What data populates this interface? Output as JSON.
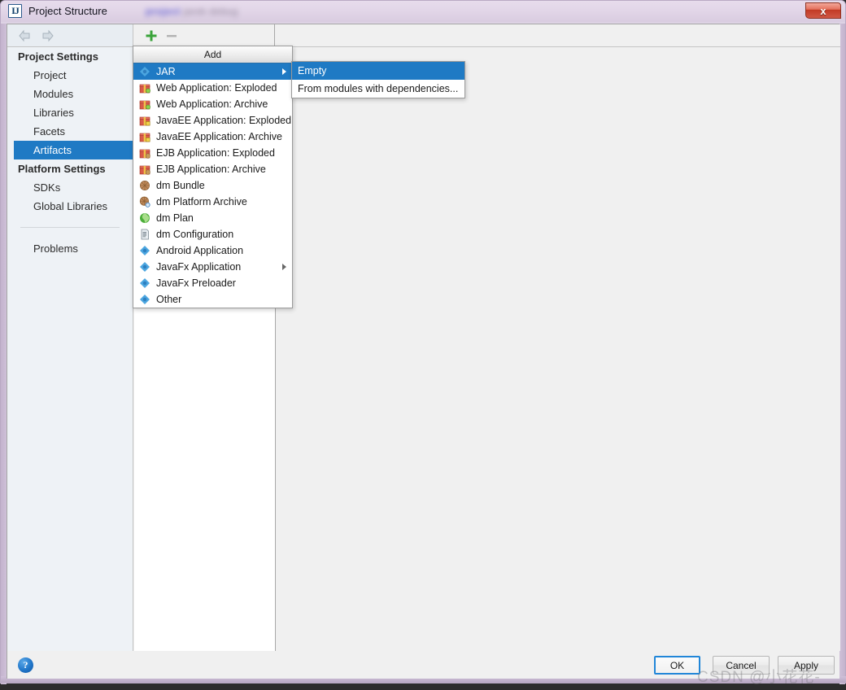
{
  "window": {
    "title": "Project Structure",
    "subtitle_blurred": "project  jarek  debug",
    "app_icon": "intellij-idea-icon",
    "close_label": "x"
  },
  "nav": {
    "back_icon": "arrow-left-icon",
    "forward_icon": "arrow-right-icon"
  },
  "toolbar": {
    "add_icon": "plus-icon",
    "remove_icon": "minus-icon"
  },
  "sidebar": {
    "groups": [
      {
        "label": "Project Settings",
        "items": [
          {
            "label": "Project",
            "selected": false
          },
          {
            "label": "Modules",
            "selected": false
          },
          {
            "label": "Libraries",
            "selected": false
          },
          {
            "label": "Facets",
            "selected": false
          },
          {
            "label": "Artifacts",
            "selected": true
          }
        ]
      },
      {
        "label": "Platform Settings",
        "items": [
          {
            "label": "SDKs",
            "selected": false
          },
          {
            "label": "Global Libraries",
            "selected": false
          }
        ]
      }
    ],
    "extra_items": [
      {
        "label": "Problems",
        "selected": false
      }
    ]
  },
  "add_menu": {
    "header": "Add",
    "items": [
      {
        "label": "JAR",
        "icon": "diamond-blue-icon",
        "selected": true,
        "has_submenu": true
      },
      {
        "label": "Web Application: Exploded",
        "icon": "web-exploded-icon",
        "selected": false,
        "has_submenu": false
      },
      {
        "label": "Web Application: Archive",
        "icon": "web-archive-icon",
        "selected": false,
        "has_submenu": false
      },
      {
        "label": "JavaEE Application: Exploded",
        "icon": "javaee-exploded-icon",
        "selected": false,
        "has_submenu": false
      },
      {
        "label": "JavaEE Application: Archive",
        "icon": "javaee-archive-icon",
        "selected": false,
        "has_submenu": false
      },
      {
        "label": "EJB Application: Exploded",
        "icon": "ejb-exploded-icon",
        "selected": false,
        "has_submenu": false
      },
      {
        "label": "EJB Application: Archive",
        "icon": "ejb-archive-icon",
        "selected": false,
        "has_submenu": false
      },
      {
        "label": "dm Bundle",
        "icon": "dm-bundle-icon",
        "selected": false,
        "has_submenu": false
      },
      {
        "label": "dm Platform Archive",
        "icon": "dm-platform-archive-icon",
        "selected": false,
        "has_submenu": false
      },
      {
        "label": "dm Plan",
        "icon": "dm-plan-globe-icon",
        "selected": false,
        "has_submenu": false
      },
      {
        "label": "dm Configuration",
        "icon": "dm-configuration-doc-icon",
        "selected": false,
        "has_submenu": false
      },
      {
        "label": "Android Application",
        "icon": "diamond-blue-icon",
        "selected": false,
        "has_submenu": false
      },
      {
        "label": "JavaFx Application",
        "icon": "diamond-blue-icon",
        "selected": false,
        "has_submenu": true
      },
      {
        "label": "JavaFx Preloader",
        "icon": "diamond-blue-icon",
        "selected": false,
        "has_submenu": false
      },
      {
        "label": "Other",
        "icon": "diamond-blue-icon",
        "selected": false,
        "has_submenu": false
      }
    ]
  },
  "jar_submenu": {
    "items": [
      {
        "label": "Empty",
        "selected": true
      },
      {
        "label": "From modules with dependencies...",
        "selected": false
      }
    ]
  },
  "footer": {
    "help_label": "?",
    "ok_label": "OK",
    "cancel_label": "Cancel",
    "apply_label": "Apply"
  },
  "watermark": "CSDN @小花花-",
  "colors": {
    "selection_blue": "#1f7ac4",
    "frame_lavender": "#dcd0e3",
    "panel_gray": "#f0f0f0",
    "sidebar_bg": "#eef2f6",
    "close_red": "#c23a25",
    "add_green": "#3aa33a"
  }
}
